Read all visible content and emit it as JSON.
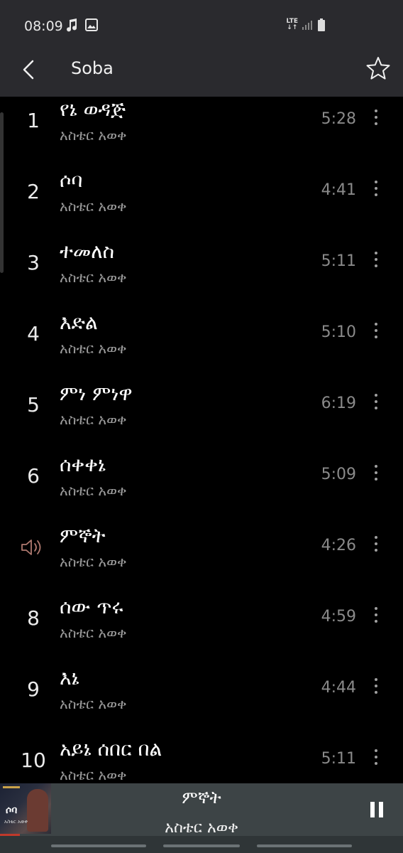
{
  "status_bar": {
    "time": "08:09",
    "network": "LTE"
  },
  "header": {
    "title": "Soba"
  },
  "tracks": [
    {
      "number": "1",
      "title": "የኔ ወዳጅ",
      "artist": "አስቴር አወቀ",
      "duration": "5:28"
    },
    {
      "number": "2",
      "title": "ሶባ",
      "artist": "አስቴር አወቀ",
      "duration": "4:41"
    },
    {
      "number": "3",
      "title": "ተመለስ",
      "artist": "አስቴር አወቀ",
      "duration": "5:11"
    },
    {
      "number": "4",
      "title": "እድል",
      "artist": "አስቴር አወቀ",
      "duration": "5:10"
    },
    {
      "number": "5",
      "title": "ምነ ምነዋ",
      "artist": "አስቴር አወቀ",
      "duration": "6:19"
    },
    {
      "number": "6",
      "title": "ሰቀቀኔ",
      "artist": "አስቴር አወቀ",
      "duration": "5:09"
    },
    {
      "number": "",
      "title": "ምኞት",
      "artist": "አስቴር አወቀ",
      "duration": "4:26",
      "playing": true
    },
    {
      "number": "8",
      "title": "ሰው ጥሩ",
      "artist": "አስቴር አወቀ",
      "duration": "4:59"
    },
    {
      "number": "9",
      "title": "እኔ",
      "artist": "አስቴር አወቀ",
      "duration": "4:44"
    },
    {
      "number": "10",
      "title": "አይኔ ሰበር በል",
      "artist": "አስቴር አወቀ",
      "duration": "5:11"
    }
  ],
  "now_playing": {
    "title": "ምኞት",
    "artist": "አስቴር አወቀ",
    "album_art_text": "ሶባ",
    "album_art_subtext": "አስቴር አወቀ",
    "progress": 0.05
  },
  "icons": {
    "back": "back-arrow-icon",
    "favorite": "star-icon",
    "more": "more-vertical-icon",
    "playing": "speaker-icon",
    "pause": "pause-icon"
  },
  "colors": {
    "background": "#000000",
    "app_bar": "#2a2a2e",
    "mini_player": "#3d4446",
    "progress": "#c0392b",
    "secondary_text": "#9a9a9a"
  }
}
